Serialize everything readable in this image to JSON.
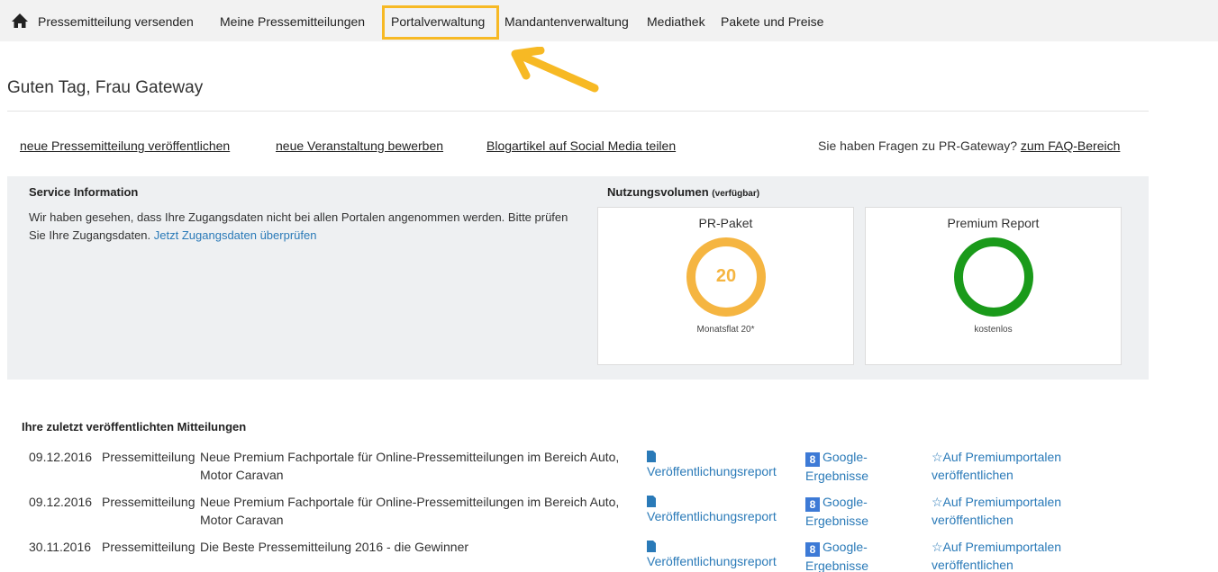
{
  "nav": {
    "home_icon": "home-icon",
    "items": [
      {
        "label": "Pressemitteilung versenden"
      },
      {
        "label": "Meine Pressemitteilungen"
      },
      {
        "label": "Portalverwaltung"
      },
      {
        "label": "Mandantenverwaltung"
      },
      {
        "label": "Mediathek"
      },
      {
        "label": "Pakete und Preise"
      }
    ],
    "highlight_color": "#f7b924"
  },
  "greeting": "Guten Tag, Frau Gateway",
  "quick_links": [
    {
      "label": "neue Pressemitteilung veröffentlichen"
    },
    {
      "label": "neue Veranstaltung bewerben"
    },
    {
      "label": "Blogartikel auf Social Media teilen"
    }
  ],
  "faq": {
    "text": "Sie haben Fragen zu PR-Gateway?",
    "link": "zum FAQ-Bereich"
  },
  "service": {
    "title": "Service Information",
    "text": "Wir haben gesehen, dass Ihre Zugangsdaten nicht bei allen Portalen angenommen werden. Bitte prüfen Sie Ihre Zugangsdaten.",
    "link": "Jetzt Zugangsdaten überprüfen"
  },
  "usage": {
    "title": "Nutzungsvolumen",
    "title_note": "(verfügbar)",
    "cards": [
      {
        "title": "PR-Paket",
        "value": "20",
        "subtitle": "Monatsflat 20*",
        "color": "#f5b541"
      },
      {
        "title": "Premium Report",
        "value": "",
        "subtitle": "kostenlos",
        "color": "#1a9a1a"
      }
    ]
  },
  "releases": {
    "title": "Ihre zuletzt veröffentlichten Mitteilungen",
    "rows": [
      {
        "date": "09.12.2016",
        "type": "Pressemitteilung",
        "title": "Neue Premium Fachportale für Online-Pressemitteilungen im Bereich Auto, Motor Caravan",
        "report": "Veröffentlichungsreport",
        "google": "Google-Ergebnisse",
        "premium": "☆Auf Premiumportalen veröffentlichen"
      },
      {
        "date": "09.12.2016",
        "type": "Pressemitteilung",
        "title": "Neue Premium Fachportale für Online-Pressemitteilungen im Bereich Auto, Motor Caravan",
        "report": "Veröffentlichungsreport",
        "google": "Google-Ergebnisse",
        "premium": "☆Auf Premiumportalen veröffentlichen"
      },
      {
        "date": "30.11.2016",
        "type": "Pressemitteilung",
        "title": "Die Beste Pressemitteilung 2016 - die Gewinner",
        "report": "Veröffentlichungsreport",
        "google": "Google-Ergebnisse",
        "premium": "☆Auf Premiumportalen veröffentlichen"
      }
    ],
    "google_icon_letter": "8"
  },
  "colors": {
    "link": "#2a7ab8",
    "panel": "#eef0f2",
    "arrow": "#f7b924"
  }
}
